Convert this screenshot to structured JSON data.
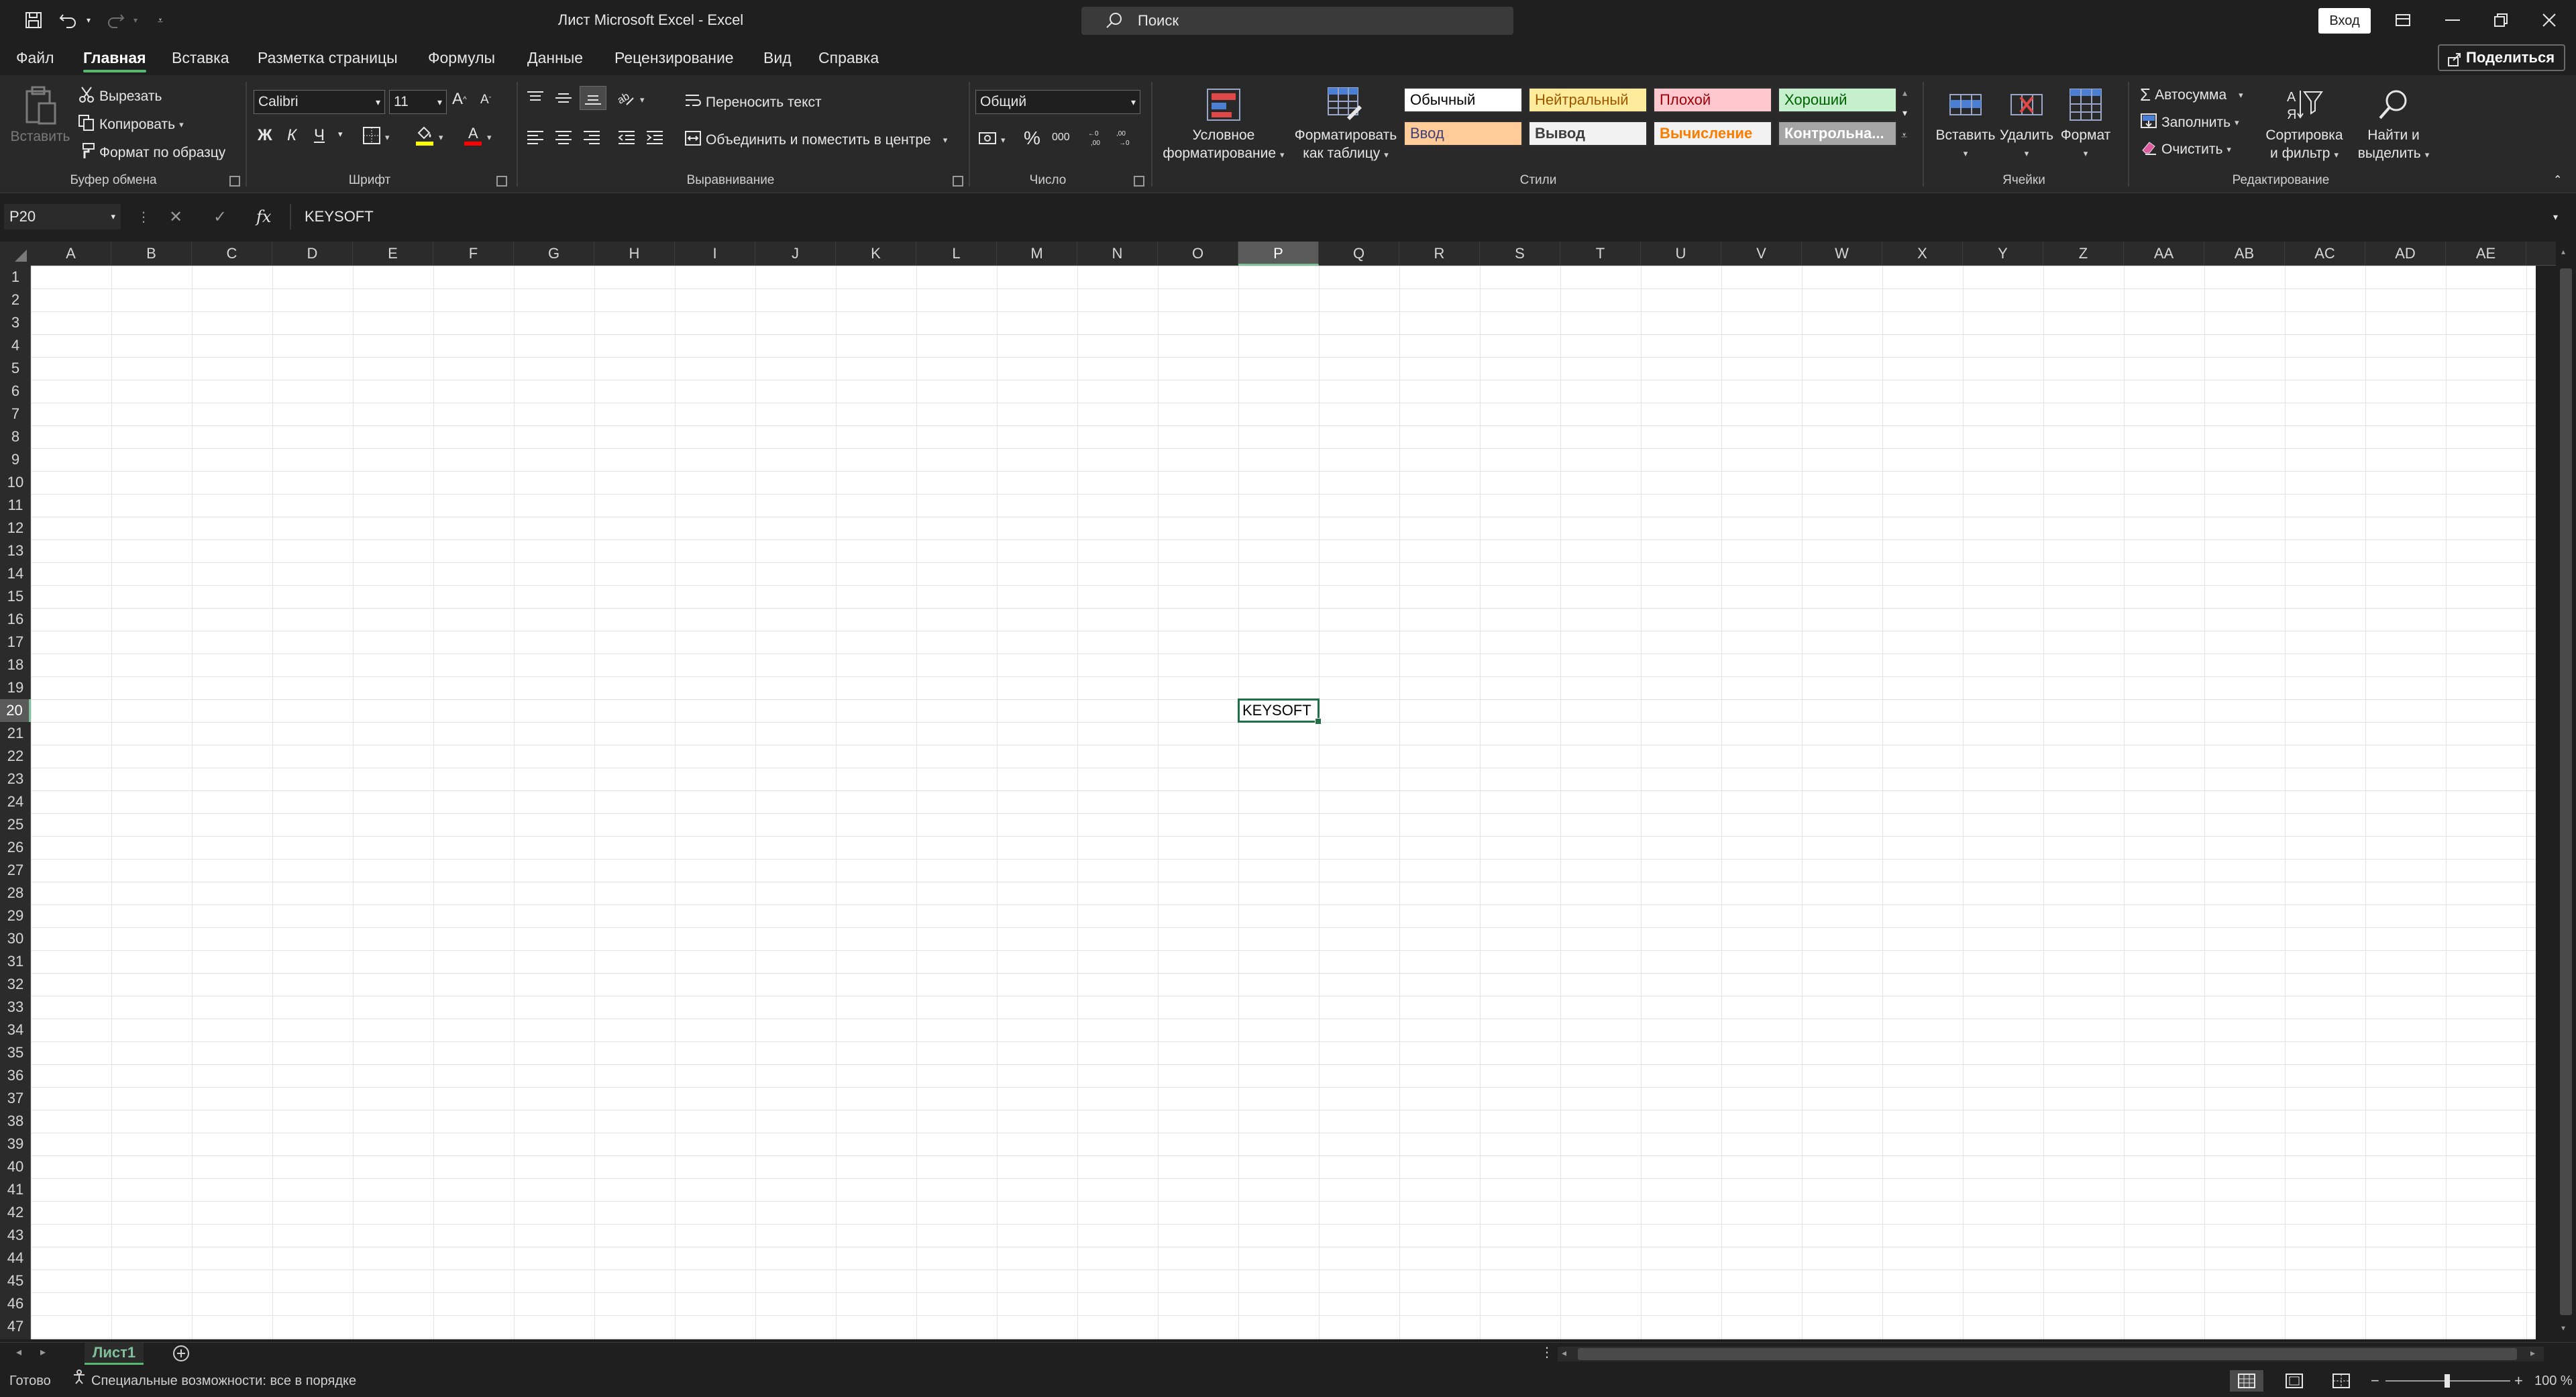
{
  "window": {
    "title": "Лист Microsoft Excel  -  Excel",
    "search_placeholder": "Поиск",
    "signin_label": "Вход"
  },
  "tabs": [
    {
      "label": "Файл"
    },
    {
      "label": "Главная",
      "active": true
    },
    {
      "label": "Вставка"
    },
    {
      "label": "Разметка страницы"
    },
    {
      "label": "Формулы"
    },
    {
      "label": "Данные"
    },
    {
      "label": "Рецензирование"
    },
    {
      "label": "Вид"
    },
    {
      "label": "Справка"
    }
  ],
  "share_label": "Поделиться",
  "ribbon": {
    "clipboard": {
      "group_label": "Буфер обмена",
      "paste_label": "Вставить",
      "cut_label": "Вырезать",
      "copy_label": "Копировать",
      "format_painter_label": "Формат по образцу"
    },
    "font": {
      "group_label": "Шрифт",
      "font_name": "Calibri",
      "font_size": "11",
      "bold_label": "Ж",
      "italic_label": "К",
      "underline_label": "Ч"
    },
    "alignment": {
      "group_label": "Выравнивание",
      "wrap_text_label": "Переносить текст",
      "merge_center_label": "Объединить и поместить в центре"
    },
    "number": {
      "group_label": "Число",
      "format_value": "Общий"
    },
    "styles": {
      "group_label": "Стили",
      "conditional_formatting_label_1": "Условное",
      "conditional_formatting_label_2": "форматирование",
      "format_as_table_label_1": "Форматировать",
      "format_as_table_label_2": "как таблицу",
      "cell_styles": [
        {
          "label": "Обычный",
          "bg": "#ffffff",
          "fg": "#000000"
        },
        {
          "label": "Нейтральный",
          "bg": "#ffeb9c",
          "fg": "#9c5700"
        },
        {
          "label": "Плохой",
          "bg": "#ffc7ce",
          "fg": "#9c0006"
        },
        {
          "label": "Хороший",
          "bg": "#c6efce",
          "fg": "#006100"
        },
        {
          "label": "Ввод",
          "bg": "#ffcc99",
          "fg": "#3f3f76"
        },
        {
          "label": "Вывод",
          "bg": "#f2f2f2",
          "fg": "#3f3f3f"
        },
        {
          "label": "Вычисление",
          "bg": "#f2f2f2",
          "fg": "#fa7d00"
        },
        {
          "label": "Контрольна...",
          "bg": "#a5a5a5",
          "fg": "#ffffff"
        }
      ]
    },
    "cells": {
      "group_label": "Ячейки",
      "insert_label": "Вставить",
      "delete_label": "Удалить",
      "format_label": "Формат"
    },
    "editing": {
      "group_label": "Редактирование",
      "autosum_label": "Автосумма",
      "fill_label": "Заполнить",
      "clear_label": "Очистить",
      "sort_filter_label_1": "Сортировка",
      "sort_filter_label_2": "и фильтр",
      "find_select_label_1": "Найти и",
      "find_select_label_2": "выделить"
    }
  },
  "formula_bar": {
    "name_box": "P20",
    "fx_label": "fx",
    "content": "KEYSOFT"
  },
  "grid": {
    "columns": [
      "A",
      "B",
      "C",
      "D",
      "E",
      "F",
      "G",
      "H",
      "I",
      "J",
      "K",
      "L",
      "M",
      "N",
      "O",
      "P",
      "Q",
      "R",
      "S",
      "T",
      "U",
      "V",
      "W",
      "X",
      "Y",
      "Z",
      "AA",
      "AB",
      "AC",
      "AD",
      "AE"
    ],
    "row_count": 47,
    "selected_column": "P",
    "selected_row": 20,
    "active_cell_value": "KEYSOFT"
  },
  "sheets": [
    {
      "label": "Лист1",
      "active": true
    }
  ],
  "status": {
    "ready": "Готово",
    "accessibility": "Специальные возможности: все в порядке",
    "zoom": "100 %"
  },
  "colors": {
    "accent": "#58b971",
    "selection_border": "#1e7145"
  }
}
